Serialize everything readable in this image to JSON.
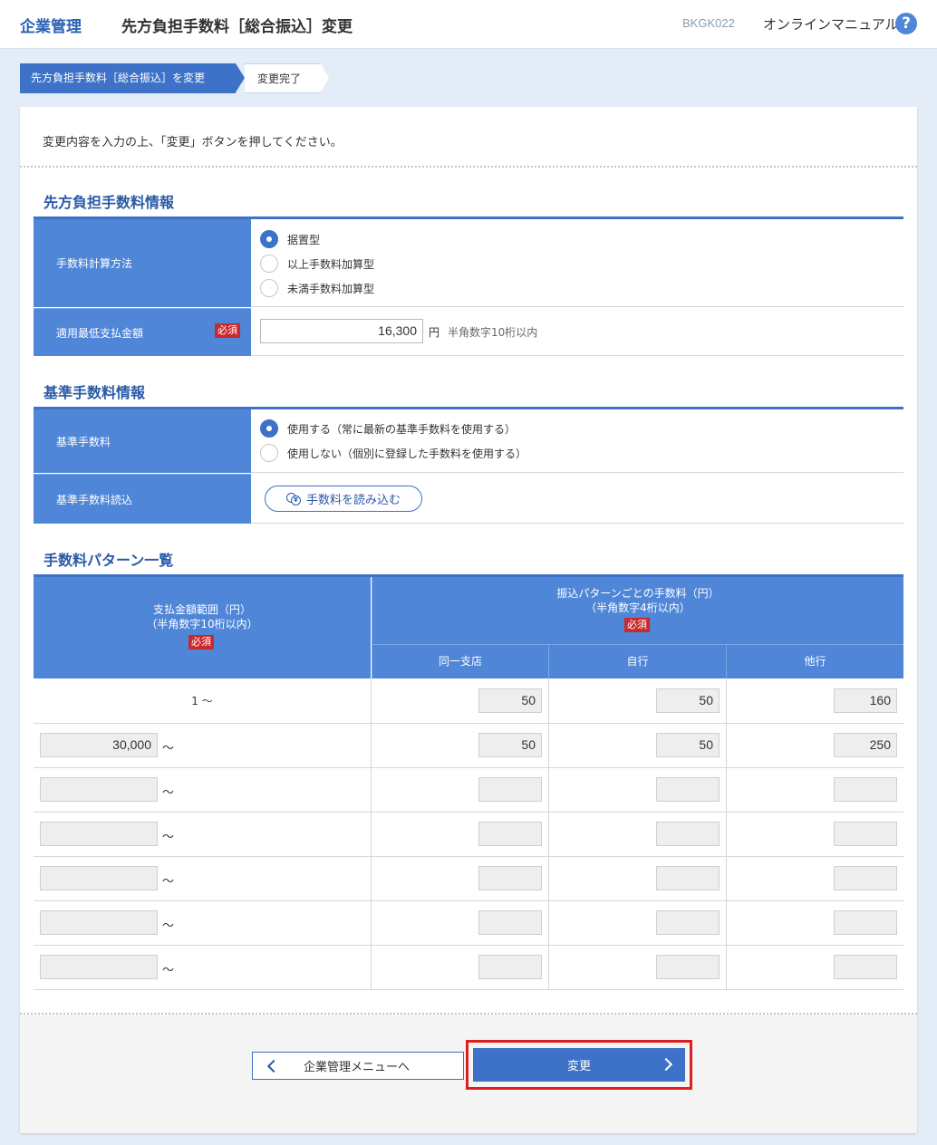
{
  "header": {
    "brand": "企業管理",
    "title": "先方負担手数料［総合振込］変更",
    "screen_id": "BKGK022",
    "manual": "オンラインマニュアル",
    "help_glyph": "?"
  },
  "steps": {
    "current": "先方負担手数料［総合振込］を変更",
    "next": "変更完了"
  },
  "instruction": "変更内容を入力の上、「変更」ボタンを押してください。",
  "fee_info": {
    "heading": "先方負担手数料情報",
    "calc_label": "手数料計算方法",
    "calc_options": [
      "据置型",
      "以上手数料加算型",
      "未満手数料加算型"
    ],
    "calc_selected": "据置型",
    "min_label": "適用最低支払金額",
    "required": "必須",
    "min_value": "16,300",
    "unit": "円",
    "min_hint": "半角数字10桁以内"
  },
  "standard_fee": {
    "heading": "基準手数料情報",
    "fee_label": "基準手数料",
    "fee_options": [
      "使用する（常に最新の基準手数料を使用する）",
      "使用しない（個別に登録した手数料を使用する）"
    ],
    "fee_selected": "使用する（常に最新の基準手数料を使用する）",
    "load_label": "基準手数料読込",
    "load_button": "手数料を読み込む",
    "load_icon_glyph": "¥"
  },
  "pattern_table": {
    "heading": "手数料パターン一覧",
    "range_header_1": "支払金額範囲（円）",
    "range_header_2": "（半角数字10桁以内）",
    "fee_header_1": "振込パターンごとの手数料（円）",
    "fee_header_2": "（半角数字4桁以内）",
    "required": "必須",
    "columns": [
      "同一支店",
      "自行",
      "他行"
    ],
    "tilde": "～",
    "first_row_label": "1 ～",
    "rows": [
      {
        "from": "",
        "same_branch": "50",
        "own_bank": "50",
        "other_bank": "160"
      },
      {
        "from": "30,000",
        "same_branch": "50",
        "own_bank": "50",
        "other_bank": "250"
      },
      {
        "from": "",
        "same_branch": "",
        "own_bank": "",
        "other_bank": ""
      },
      {
        "from": "",
        "same_branch": "",
        "own_bank": "",
        "other_bank": ""
      },
      {
        "from": "",
        "same_branch": "",
        "own_bank": "",
        "other_bank": ""
      },
      {
        "from": "",
        "same_branch": "",
        "own_bank": "",
        "other_bank": ""
      },
      {
        "from": "",
        "same_branch": "",
        "own_bank": "",
        "other_bank": ""
      }
    ]
  },
  "footer": {
    "back_button": "企業管理メニューへ",
    "submit_button": "変更"
  },
  "colors": {
    "accent": "#3d72c8",
    "label_bg": "#4f86d8",
    "required": "#c9282d",
    "highlight_frame": "#e01e1e"
  },
  "icons": {
    "help": "help-icon",
    "coin": "coin-icon",
    "back": "chevron-left-icon",
    "submit": "chevron-right-icon"
  }
}
